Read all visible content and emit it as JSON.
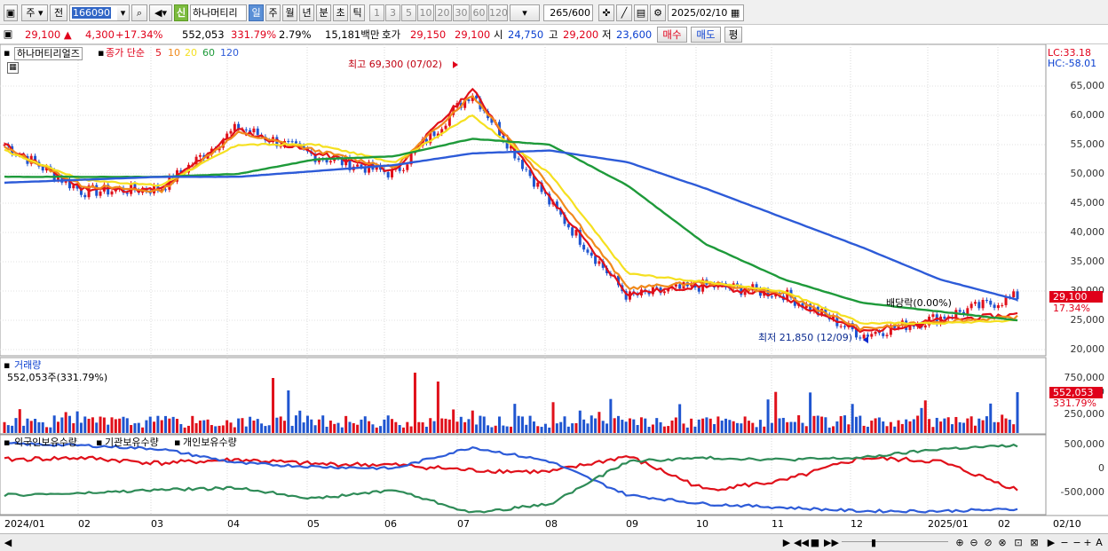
{
  "toolbar": {
    "market_type": "주",
    "prev_label": "전",
    "code": "166090",
    "badge_new": "신",
    "stock_name": "하나머티리",
    "periods": [
      "일",
      "주",
      "월",
      "년",
      "분",
      "초",
      "틱"
    ],
    "selected_period": "일",
    "intervals": [
      "1",
      "3",
      "5",
      "10",
      "20",
      "30",
      "60",
      "120"
    ],
    "count": "265",
    "count_max": "/600",
    "date": "2025/02/10"
  },
  "quote": {
    "price": "29,100",
    "change": "4,300",
    "change_pct": "+17.34%",
    "volume": "552,053",
    "volume_ratio": "331.79%",
    "turnover": "2.79%",
    "amount": "15,181백만",
    "ask_label": "호가",
    "ask": "29,150",
    "bid": "29,100",
    "open_label": "시",
    "open": "24,750",
    "high_label": "고",
    "high": "29,200",
    "low_label": "저",
    "low": "23,600",
    "buy_btn": "매수",
    "sell_btn": "매도",
    "eval_btn": "평"
  },
  "price_panel": {
    "title": "하나머티리얼즈",
    "ma_label": "종가 단순",
    "ma_periods": [
      "5",
      "10",
      "20",
      "60",
      "120"
    ],
    "ma_colors": [
      "#e0101a",
      "#f08a1c",
      "#f5e020",
      "#1e9a3a",
      "#2d5bd8"
    ],
    "lc": "LC:33.18",
    "hc": "HC:-58.01",
    "high_note": "최고 69,300 (07/02)",
    "low_note": "최저 21,850 (12/09)",
    "dividend_note": "배당락(0.00%)",
    "last_price_tag": "29,100",
    "last_pct_tag": "17.34%",
    "y_ticks": [
      "65,000",
      "60,000",
      "55,000",
      "50,000",
      "45,000",
      "40,000",
      "35,000",
      "30,000",
      "25,000",
      "20,000"
    ]
  },
  "volume_panel": {
    "title": "거래량",
    "value": "552,053주(331.79%)",
    "tag_value": "552,053",
    "tag_pct": "331.79%",
    "y_ticks": [
      "750,000",
      "500,000",
      "250,000"
    ]
  },
  "holding_panel": {
    "series": [
      "외국인보유수량",
      "기관보유수량",
      "개인보유수량"
    ],
    "series_colors": [
      "#e0101a",
      "#2d5bd8",
      "#2e8b57"
    ],
    "y_ticks": [
      "500,000",
      "0",
      "-500,000"
    ]
  },
  "x_axis": {
    "labels": [
      "2024/01",
      "02",
      "03",
      "04",
      "05",
      "06",
      "07",
      "08",
      "09",
      "10",
      "11",
      "12",
      "2025/01",
      "02"
    ],
    "end_label": "02/10"
  },
  "chart_data": {
    "type": "line",
    "title": "하나머티리얼즈",
    "ylim": [
      20000,
      70000
    ],
    "series": [
      {
        "name": "종가",
        "x": [
          "2024/01",
          "2024/02",
          "2024/03",
          "2024/04",
          "2024/05",
          "2024/06",
          "2024/07",
          "2024/08",
          "2024/09",
          "2024/10",
          "2024/11",
          "2024/12",
          "2025/01",
          "2025/02/10"
        ],
        "values": [
          55000,
          47000,
          47500,
          58000,
          53000,
          50000,
          64000,
          45000,
          29000,
          31000,
          29500,
          22500,
          25500,
          29100
        ]
      },
      {
        "name": "5",
        "values": [
          55000,
          47500,
          47200,
          57500,
          53500,
          50500,
          64500,
          46000,
          29500,
          31000,
          29000,
          23000,
          25000,
          26000
        ]
      },
      {
        "name": "10",
        "values": [
          54500,
          48000,
          47000,
          57000,
          54000,
          51000,
          63500,
          48000,
          30500,
          31500,
          29500,
          23500,
          24800,
          25500
        ]
      },
      {
        "name": "20",
        "values": [
          54000,
          49000,
          48000,
          55000,
          55000,
          52000,
          60000,
          50000,
          33000,
          31500,
          30000,
          24500,
          24500,
          25000
        ]
      },
      {
        "name": "60",
        "values": [
          49500,
          49500,
          49500,
          50000,
          52500,
          53000,
          56000,
          55000,
          48000,
          38000,
          32000,
          28000,
          26500,
          25000
        ]
      },
      {
        "name": "120",
        "values": [
          48500,
          49000,
          49500,
          49500,
          50500,
          51500,
          53500,
          54000,
          52000,
          47500,
          42500,
          37500,
          32000,
          28500
        ]
      }
    ],
    "high": {
      "value": 69300,
      "date": "07/02"
    },
    "low": {
      "value": 21850,
      "date": "12/09"
    }
  }
}
